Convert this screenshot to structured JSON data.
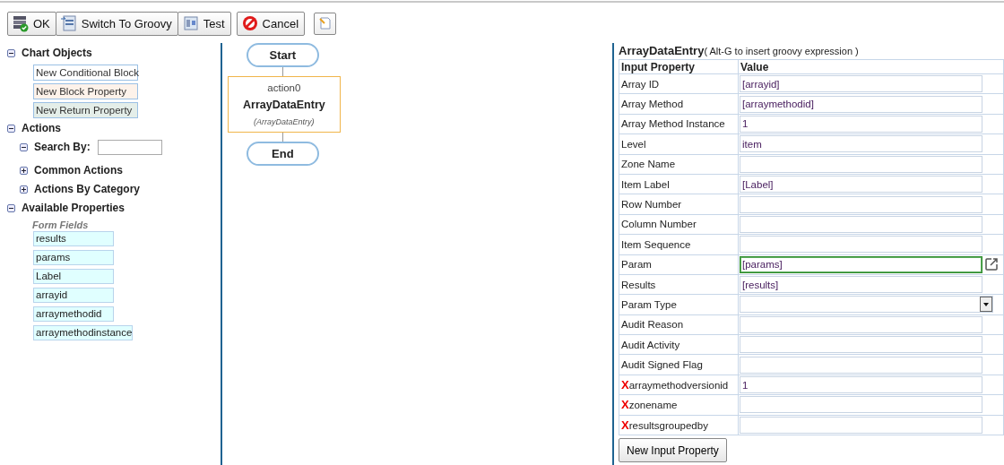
{
  "toolbar": {
    "buttons": [
      {
        "label": "OK",
        "kind": "ok"
      },
      {
        "label": "Switch To Groovy",
        "kind": "groovy"
      },
      {
        "label": "Test",
        "kind": "test"
      }
    ],
    "cancel": {
      "label": "Cancel"
    },
    "notes_button": {
      "kind": "notes"
    }
  },
  "sidebar": {
    "sections": [
      {
        "label": "Chart Objects",
        "expanded": true,
        "items": [
          {
            "label": "New Conditional Block",
            "kind": "conditional"
          },
          {
            "label": "New Block Property",
            "kind": "block"
          },
          {
            "label": "New Return Property",
            "kind": "return"
          }
        ]
      },
      {
        "label": "Actions",
        "expanded": true,
        "children": [
          {
            "label": "Search By:",
            "expanded": true,
            "kind": "search"
          },
          {
            "label": "Common Actions",
            "expanded": false,
            "kind": "group"
          },
          {
            "label": "Actions By Category",
            "expanded": false,
            "kind": "group"
          }
        ]
      },
      {
        "label": "Available Properties",
        "expanded": true,
        "group": "Form Fields",
        "fields": [
          "results",
          "params",
          "Label",
          "arrayid",
          "arraymethodid",
          "arraymethodinstance"
        ]
      }
    ]
  },
  "flow": {
    "start": "Start",
    "action": {
      "name": "action0",
      "title": "ArrayDataEntry",
      "type": "(ArrayDataEntry)"
    },
    "end": "End"
  },
  "properties": {
    "title": "ArrayDataEntry",
    "hint": "( Alt-G to insert groovy expression )",
    "columns": [
      "Input Property",
      "Value"
    ],
    "rows": [
      {
        "label": "Array ID",
        "value": "[arrayid]",
        "kind": "text",
        "focused": false
      },
      {
        "label": "Array Method",
        "value": "[arraymethodid]",
        "kind": "text",
        "focused": false
      },
      {
        "label": "Array Method Instance",
        "value": "1",
        "kind": "text",
        "focused": false
      },
      {
        "label": "Level",
        "value": "item",
        "kind": "text",
        "focused": false
      },
      {
        "label": "Zone Name",
        "kind": "text",
        "focused": false
      },
      {
        "label": "Item Label",
        "value": "[Label]",
        "kind": "text",
        "focused": false
      },
      {
        "label": "Row Number",
        "kind": "text",
        "focused": false
      },
      {
        "label": "Column Number",
        "kind": "text",
        "focused": false
      },
      {
        "label": "Item Sequence",
        "kind": "text",
        "focused": false
      },
      {
        "label": "Param",
        "value": "[params]",
        "kind": "link",
        "focused": true
      },
      {
        "label": "Results",
        "value": "[results]",
        "kind": "text",
        "focused": false
      },
      {
        "label": "Param Type",
        "kind": "select",
        "focused": false
      },
      {
        "label": "Audit Reason",
        "kind": "text",
        "focused": false
      },
      {
        "label": "Audit Activity",
        "kind": "text",
        "focused": false
      },
      {
        "label": "Audit Signed Flag",
        "kind": "text",
        "focused": false
      },
      {
        "label": "arraymethodversionid",
        "marker": "X",
        "value": "1",
        "kind": "text",
        "focused": false
      },
      {
        "label": "zonename",
        "marker": "X",
        "kind": "text",
        "focused": false
      },
      {
        "label": "resultsgroupedby",
        "marker": "X",
        "kind": "text",
        "focused": false
      }
    ],
    "add_button": "New Input Property"
  }
}
